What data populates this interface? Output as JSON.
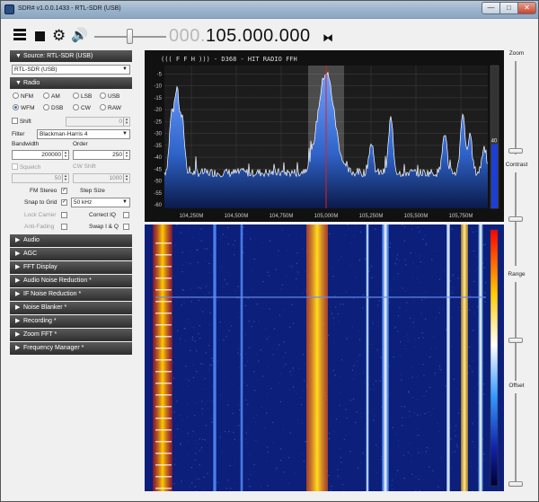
{
  "window": {
    "title": "SDR# v1.0.0.1433 - RTL-SDR (USB)",
    "min_label": "—",
    "max_label": "□",
    "close_label": "✕"
  },
  "toolbar": {
    "menu_icon": "menu-icon",
    "stop_icon": "stop-icon",
    "gear_icon": "gear-icon",
    "speaker_icon": "speaker-icon",
    "speaker_glyph": "🔊",
    "gear_glyph": "⚙",
    "freq_dim": "000.",
    "freq_bright": "105.000.000",
    "tune_glyph": "⧓"
  },
  "source": {
    "header": "Source: RTL-SDR (USB)",
    "device": "RTL-SDR (USB)"
  },
  "radio": {
    "header": "Radio",
    "modes": [
      "NFM",
      "AM",
      "LSB",
      "USB",
      "WFM",
      "DSB",
      "CW",
      "RAW"
    ],
    "selected_mode": "WFM",
    "shift_label": "Shift",
    "shift_value": "0",
    "filter_label": "Filter",
    "filter_value": "Blackman-Harris 4",
    "bandwidth_label": "Bandwidth",
    "bandwidth_value": "200000",
    "order_label": "Order",
    "order_value": "250",
    "squelch_label": "Squelch",
    "squelch_value": "50",
    "cw_shift_label": "CW Shift",
    "cw_shift_value": "1000",
    "fm_stereo_label": "FM Stereo",
    "step_size_label": "Step Size",
    "snap_label": "Snap to Grid",
    "step_value": "50 kHz",
    "lock_carrier_label": "Lock Carrier",
    "correct_iq_label": "Correct IQ",
    "anti_fading_label": "Anti-Fading",
    "swap_iq_label": "Swap I & Q"
  },
  "sections": [
    "Audio",
    "AGC",
    "FFT Display",
    "Audio Noise Reduction *",
    "IF Noise Reduction *",
    "Noise Blanker *",
    "Recording *",
    "Zoom FFT *",
    "Frequency Manager *"
  ],
  "spectrum": {
    "rds_text": "(((  F F H   )))  - D368 - HIT RADIO FFH",
    "y_ticks": [
      "-5",
      "-10",
      "-15",
      "-20",
      "-25",
      "-30",
      "-35",
      "-40",
      "-45",
      "-50",
      "-55",
      "-60"
    ],
    "x_ticks": [
      "104,250M",
      "104,500M",
      "104,750M",
      "105,000M",
      "105,250M",
      "105,500M",
      "105,750M"
    ],
    "level_value": "40",
    "level_fraction": 0.45
  },
  "right_sliders": {
    "zoom_label": "Zoom",
    "contrast_label": "Contrast",
    "range_label": "Range",
    "offset_label": "Offset"
  },
  "colors": {
    "spectrum_fill": "#2f63c8",
    "center_line": "#e02020",
    "waterfall_bg": "#0c1f7a"
  }
}
